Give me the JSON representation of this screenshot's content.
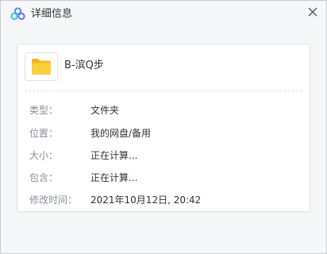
{
  "window": {
    "title": "详细信息",
    "app_icon": "baidu-netdisk-logo",
    "close_icon": "close-x"
  },
  "file": {
    "name": "B-滨Q步",
    "icon": "folder-icon",
    "folder_color": "#f7c52e"
  },
  "details": [
    {
      "label": "类型：",
      "value": "文件夹"
    },
    {
      "label": "位置：",
      "value": "我的网盘/备用"
    },
    {
      "label": "大小：",
      "value": "正在计算..."
    },
    {
      "label": "包含：",
      "value": "正在计算..."
    },
    {
      "label": "修改时间：",
      "value": "2021年10月12日, 20:42"
    }
  ],
  "colors": {
    "background": "#f6f7f9",
    "card": "#ffffff",
    "label": "#8a8f99",
    "value": "#333333"
  }
}
